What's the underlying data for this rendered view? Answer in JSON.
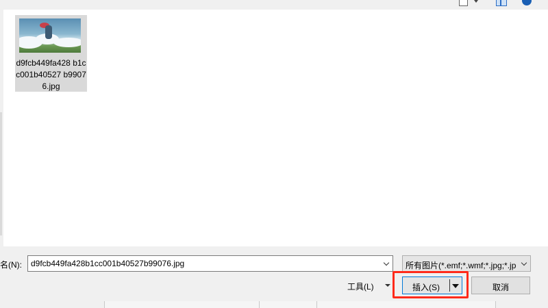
{
  "toolbar": {
    "icons": [
      "view-menu-icon",
      "dropdown-arrow-icon",
      "preview-pane-icon",
      "help-icon"
    ]
  },
  "file_list": {
    "items": [
      {
        "name": "d9fcb449fa428b1cc001b40527b99076.jpg",
        "name_display": "d9fcb449fa428 b1cc001b40527 b99076.jpg",
        "selected": true
      }
    ]
  },
  "footer": {
    "filename_label": "名(N):",
    "filename_value": "d9fcb449fa428b1cc001b40527b99076.jpg",
    "filetype_value": "所有图片(*.emf;*.wmf;*.jpg;*.jp",
    "tools_label": "工具(L)",
    "insert_label": "插入(S)",
    "cancel_label": "取消"
  },
  "colors": {
    "highlight": "#ff2a1a",
    "primary_border": "#0078d7",
    "help_icon": "#1a5fb4"
  }
}
